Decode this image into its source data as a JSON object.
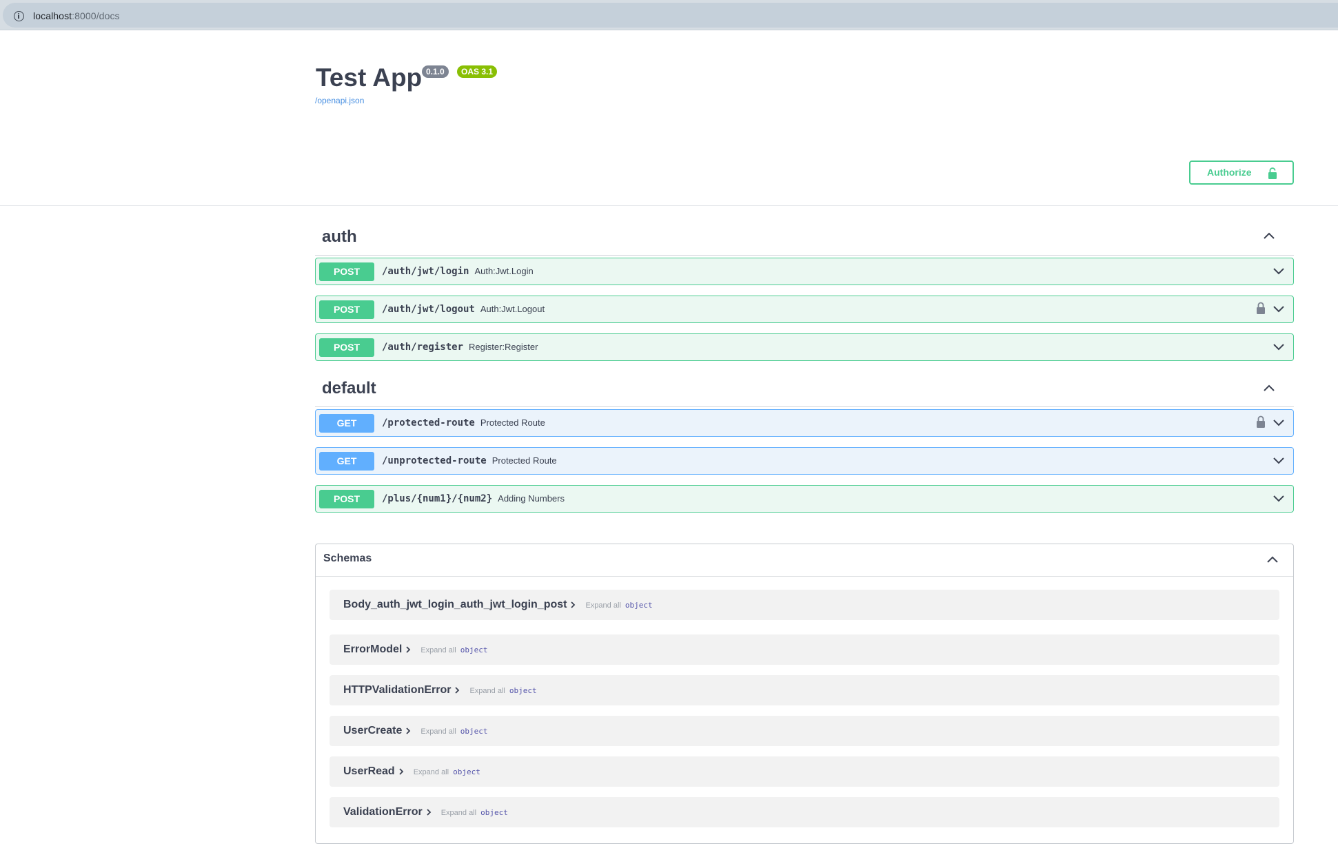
{
  "browser": {
    "url_host": "localhost",
    "url_rest": ":8000/docs"
  },
  "info": {
    "title": "Test App",
    "version_badge": "0.1.0",
    "oas_badge": "OAS 3.1",
    "spec_link": "/openapi.json"
  },
  "authorize": {
    "label": "Authorize"
  },
  "tags": [
    {
      "name": "auth",
      "operations": [
        {
          "method": "POST",
          "path": "/auth/jwt/login",
          "summary": "Auth:Jwt.Login",
          "locked": false
        },
        {
          "method": "POST",
          "path": "/auth/jwt/logout",
          "summary": "Auth:Jwt.Logout",
          "locked": true
        },
        {
          "method": "POST",
          "path": "/auth/register",
          "summary": "Register:Register",
          "locked": false
        }
      ]
    },
    {
      "name": "default",
      "operations": [
        {
          "method": "GET",
          "path": "/protected-route",
          "summary": "Protected Route",
          "locked": true
        },
        {
          "method": "GET",
          "path": "/unprotected-route",
          "summary": "Protected Route",
          "locked": false
        },
        {
          "method": "POST",
          "path": "/plus/{num1}/{num2}",
          "summary": "Adding Numbers",
          "locked": false
        }
      ]
    }
  ],
  "schemas": {
    "title": "Schemas",
    "models": [
      {
        "name": "Body_auth_jwt_login_auth_jwt_login_post",
        "expand": "Expand all",
        "type": "object"
      },
      {
        "name": "ErrorModel",
        "expand": "Expand all",
        "type": "object"
      },
      {
        "name": "HTTPValidationError",
        "expand": "Expand all",
        "type": "object"
      },
      {
        "name": "UserCreate",
        "expand": "Expand all",
        "type": "object"
      },
      {
        "name": "UserRead",
        "expand": "Expand all",
        "type": "object"
      },
      {
        "name": "ValidationError",
        "expand": "Expand all",
        "type": "object"
      }
    ]
  },
  "colors": {
    "post": "#49cc90",
    "get": "#61affe",
    "text": "#3b4151",
    "oas_badge": "#89bf04",
    "version_badge": "#7d8492"
  }
}
